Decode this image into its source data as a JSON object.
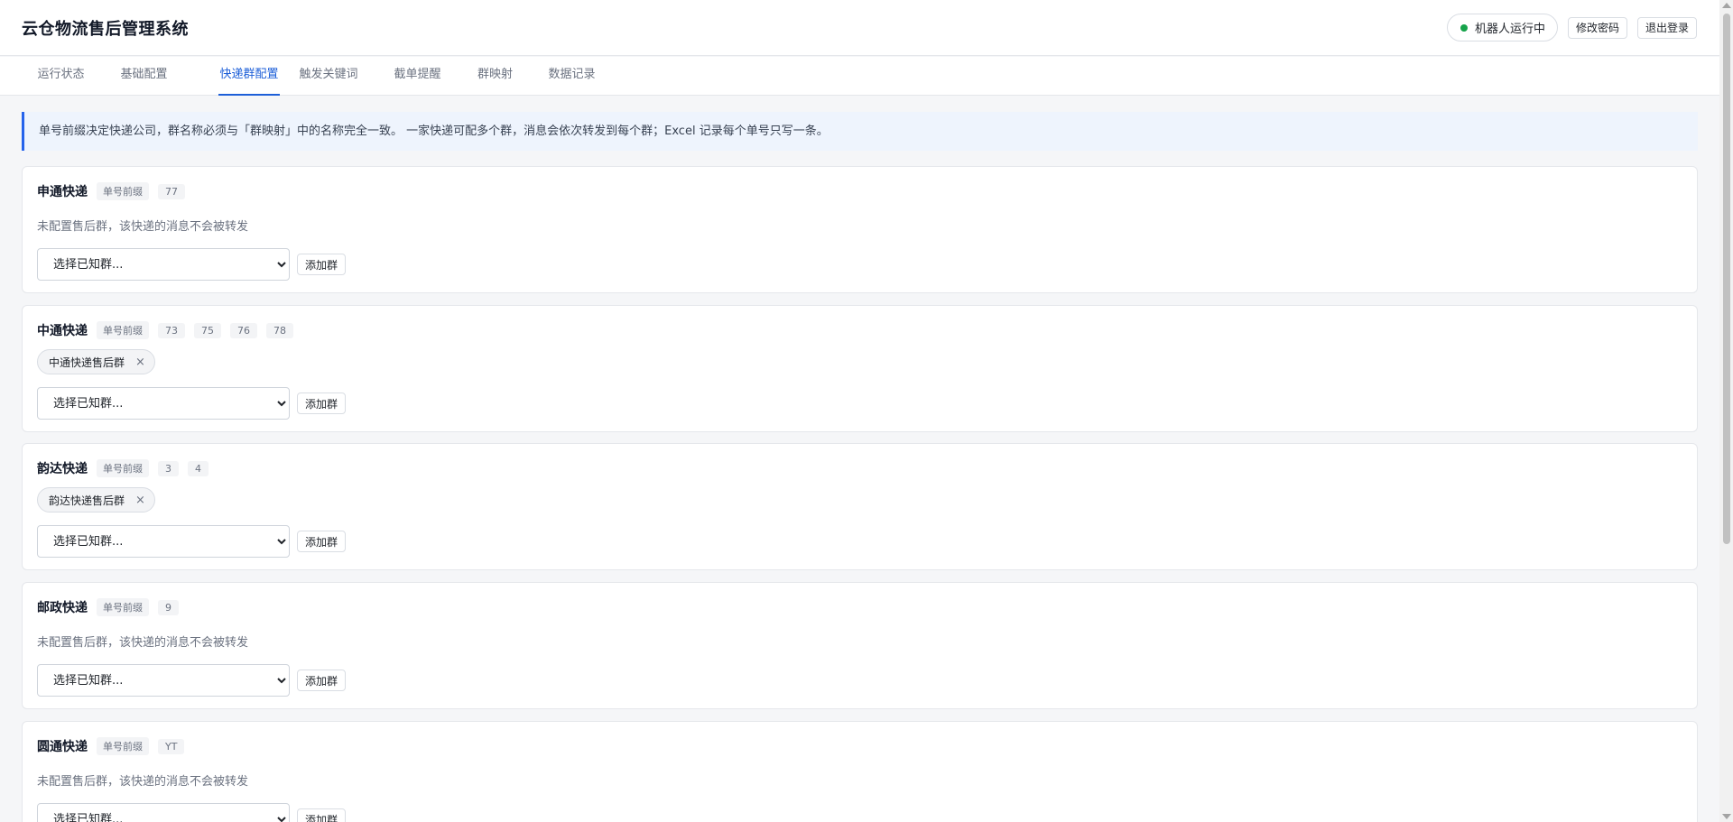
{
  "app": {
    "title": "云仓物流售后管理系统",
    "bot_status": "机器人运行中",
    "change_password": "修改密码",
    "logout": "退出登录",
    "status_color": "#16a34a",
    "accent_color": "#1d5fd8"
  },
  "tabs": [
    {
      "label": "运行状态",
      "active": false
    },
    {
      "label": "基础配置",
      "active": false
    },
    {
      "label": "快递群配置",
      "active": true
    },
    {
      "label": "触发关键词",
      "active": false
    },
    {
      "label": "截单提醒",
      "active": false
    },
    {
      "label": "群映射",
      "active": false
    },
    {
      "label": "数据记录",
      "active": false
    }
  ],
  "notice": "单号前缀决定快递公司，群名称必须与「群映射」中的名称完全一致。 一家快递可配多个群，消息会依次转发到每个群；Excel 记录每个单号只写一条。",
  "common": {
    "prefix_label": "单号前缀",
    "empty_note": "未配置售后群，该快递的消息不会被转发",
    "select_placeholder": "选择已知群...",
    "add_button": "添加群",
    "remove_icon": "×"
  },
  "carriers": [
    {
      "name": "申通快递",
      "prefixes": [
        "77"
      ],
      "groups": []
    },
    {
      "name": "中通快递",
      "prefixes": [
        "73",
        "75",
        "76",
        "78"
      ],
      "groups": [
        "中通快递售后群"
      ]
    },
    {
      "name": "韵达快递",
      "prefixes": [
        "3",
        "4"
      ],
      "groups": [
        "韵达快递售后群"
      ]
    },
    {
      "name": "邮政快递",
      "prefixes": [
        "9"
      ],
      "groups": []
    },
    {
      "name": "圆通快递",
      "prefixes": [
        "YT"
      ],
      "groups": []
    }
  ]
}
